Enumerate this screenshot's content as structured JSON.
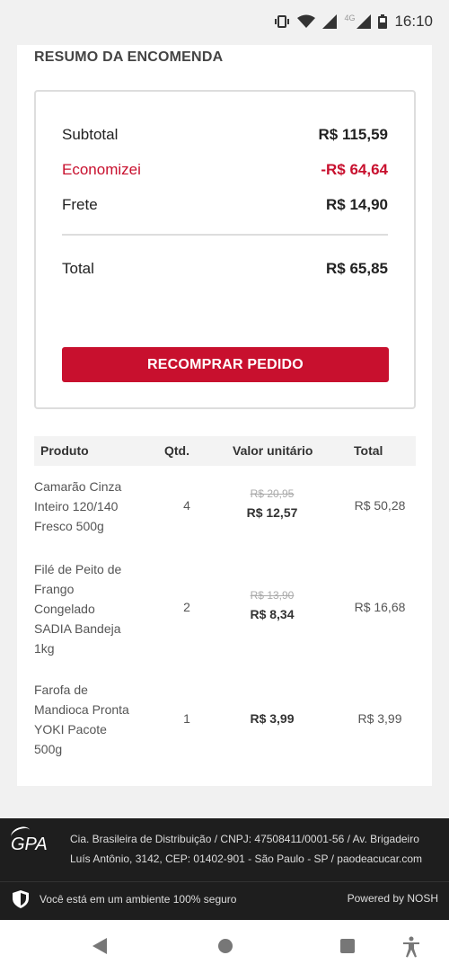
{
  "status_bar": {
    "network": "4G",
    "time": "16:10"
  },
  "section": {
    "title": "RESUMO DA ENCOMENDA"
  },
  "summary": {
    "subtotal_label": "Subtotal",
    "subtotal_value": "R$ 115,59",
    "saved_label": "Economizei",
    "saved_value": "-R$ 64,64",
    "shipping_label": "Frete",
    "shipping_value": "R$ 14,90",
    "total_label": "Total",
    "total_value": "R$ 65,85",
    "rebuy_button": "RECOMPRAR PEDIDO"
  },
  "table": {
    "headers": [
      "Produto",
      "Qtd.",
      "Valor unitário",
      "Total"
    ],
    "rows": [
      {
        "product": "Camarão Cinza Inteiro 120/140 Fresco 500g",
        "qty": "4",
        "old_price": "R$ 20,95",
        "unit_price": "R$ 12,57",
        "total": "R$ 50,28"
      },
      {
        "product": "Filé de Peito de Frango Congelado SADIA Bandeja 1kg",
        "qty": "2",
        "old_price": "R$ 13,90",
        "unit_price": "R$ 8,34",
        "total": "R$ 16,68"
      },
      {
        "product": "Farofa de Mandioca Pronta YOKI Pacote 500g",
        "qty": "1",
        "old_price": "",
        "unit_price": "R$ 3,99",
        "total": "R$ 3,99"
      }
    ]
  },
  "footer": {
    "logo_text": "GPA",
    "company_info": "Cia. Brasileira de Distribuição / CNPJ: 47508411/0001-56 / Av. Brigadeiro Luís Antônio, 3142, CEP: 01402-901 - São Paulo - SP / paodeacucar.com",
    "secure_text": "Você está em um ambiente 100% seguro",
    "powered_by": "Powered by NOSH"
  },
  "colors": {
    "accent": "#c8102e",
    "footer_bg": "#1e1e1e"
  }
}
